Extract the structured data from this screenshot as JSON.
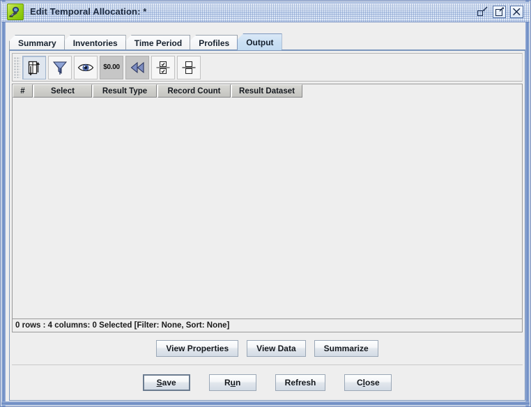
{
  "window": {
    "title": "Edit Temporal Allocation: *",
    "app_icon": "telescope-icon",
    "controls": [
      {
        "name": "restore-button",
        "label": "Restore"
      },
      {
        "name": "maximize-button",
        "label": "Maximize"
      },
      {
        "name": "close-button",
        "label": "Close"
      }
    ]
  },
  "tabs": [
    {
      "label": "Summary",
      "selected": false
    },
    {
      "label": "Inventories",
      "selected": false
    },
    {
      "label": "Time Period",
      "selected": false
    },
    {
      "label": "Profiles",
      "selected": false
    },
    {
      "label": "Output",
      "selected": true
    }
  ],
  "toolbar": {
    "grip": "drag-handle",
    "buttons": [
      {
        "name": "sort-columns-button",
        "icon": "column-sort-icon",
        "state": "pressed",
        "tooltip": "Sort"
      },
      {
        "name": "filter-button",
        "icon": "funnel-icon",
        "state": "normal",
        "tooltip": "Filter"
      },
      {
        "name": "show-hide-button",
        "icon": "eye-icon",
        "state": "normal",
        "tooltip": "Show/Hide Columns"
      },
      {
        "name": "format-button",
        "icon": "currency-icon",
        "state": "gray",
        "tooltip": "Format",
        "text": "$0.00"
      },
      {
        "name": "rewind-button",
        "icon": "rewind-icon",
        "state": "gray",
        "tooltip": "Rewind"
      },
      {
        "name": "select-rows-button",
        "icon": "select-rows-icon",
        "state": "normal",
        "tooltip": "Select Rows"
      },
      {
        "name": "split-view-button",
        "icon": "split-view-icon",
        "state": "normal",
        "tooltip": "Split View"
      }
    ]
  },
  "table": {
    "columns": [
      "#",
      "Select",
      "Result Type",
      "Record Count",
      "Result Dataset"
    ],
    "rows": [],
    "status": "0 rows : 4 columns: 0 Selected [Filter: None, Sort: None]"
  },
  "actions": {
    "view_properties": "View Properties",
    "view_data": "View Data",
    "summarize": "Summarize"
  },
  "footer": {
    "save": {
      "pre": "",
      "mnemonic": "S",
      "post": "ave",
      "focused": true
    },
    "run": {
      "pre": "R",
      "mnemonic": "u",
      "post": "n",
      "focused": false
    },
    "refresh": {
      "pre": "Refresh",
      "mnemonic": "",
      "post": "",
      "focused": false
    },
    "close": {
      "pre": "C",
      "mnemonic": "l",
      "post": "ose",
      "focused": false
    }
  },
  "colors": {
    "frame": "#6a86bd",
    "panel_bg": "#eeeeee",
    "tab_selected": "#c9dff3",
    "header_cell": "#cdcdc9"
  }
}
